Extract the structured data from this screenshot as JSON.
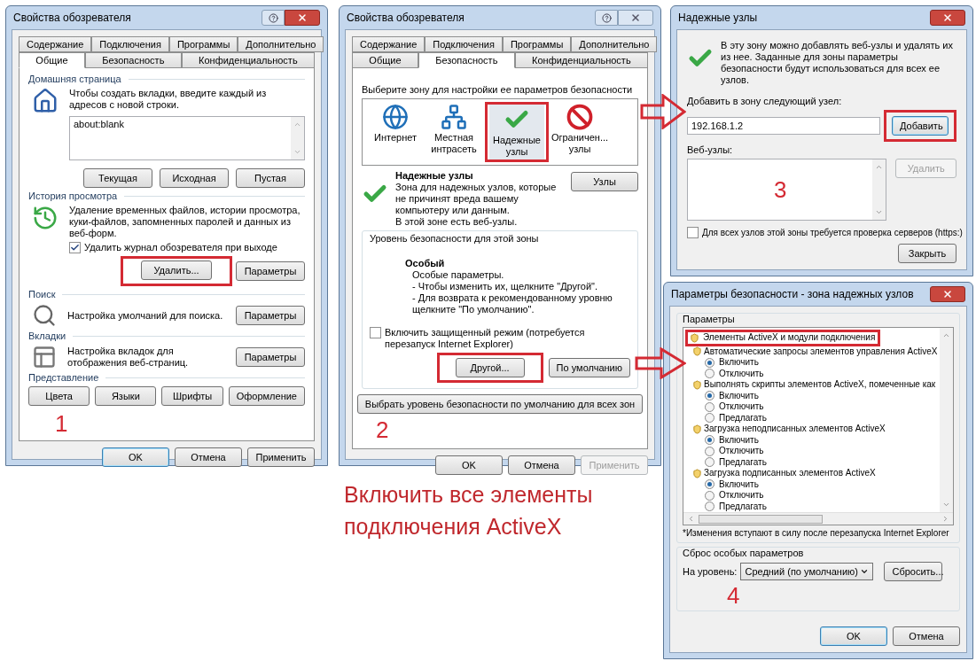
{
  "general_dialog": {
    "title": "Свойства обозревателя",
    "active": true,
    "has_help": true,
    "tab_rows": [
      [
        {
          "label": "Содержание",
          "selected": false
        },
        {
          "label": "Подключения",
          "selected": false
        },
        {
          "label": "Программы",
          "selected": false
        },
        {
          "label": "Дополнительно",
          "selected": false
        }
      ],
      [
        {
          "label": "Общие",
          "selected": true
        },
        {
          "label": "Безопасность",
          "selected": false
        },
        {
          "label": "Конфиденциальность",
          "selected": false
        }
      ]
    ],
    "home": {
      "label": "Домашняя страница",
      "text": "Чтобы создать вкладки, введите каждый из адресов с новой строки.",
      "value": "about:blank",
      "buttons": [
        "Текущая",
        "Исходная",
        "Пустая"
      ]
    },
    "history": {
      "label": "История просмотра",
      "text": "Удаление временных файлов, истории просмотра, куки-файлов, запомненных паролей и данных из веб-форм.",
      "checkbox": {
        "label": "Удалить журнал обозревателя при выходе",
        "checked": true
      },
      "buttons": [
        "Удалить...",
        "Параметры"
      ]
    },
    "search": {
      "label": "Поиск",
      "text": "Настройка умолчаний для поиска.",
      "button": "Параметры"
    },
    "tabs": {
      "label": "Вкладки",
      "text": "Настройка вкладок для отображения веб-страниц.",
      "button": "Параметры"
    },
    "appearance": {
      "label": "Представление",
      "buttons": [
        "Цвета",
        "Языки",
        "Шрифты",
        "Оформление"
      ]
    },
    "step": "1",
    "footer_buttons": [
      {
        "label": "OK",
        "default": true,
        "disabled": false
      },
      {
        "label": "Отмена",
        "default": false,
        "disabled": false
      },
      {
        "label": "Применить",
        "default": false,
        "disabled": false
      }
    ]
  },
  "security_dialog": {
    "title": "Свойства обозревателя",
    "active": false,
    "has_help": true,
    "tab_rows": [
      [
        {
          "label": "Содержание",
          "selected": false
        },
        {
          "label": "Подключения",
          "selected": false
        },
        {
          "label": "Программы",
          "selected": false
        },
        {
          "label": "Дополнительно",
          "selected": false
        }
      ],
      [
        {
          "label": "Общие",
          "selected": false
        },
        {
          "label": "Безопасность",
          "selected": true
        },
        {
          "label": "Конфиденциальность",
          "selected": false
        }
      ]
    ],
    "zone_prompt": "Выберите зону для настройки ее параметров безопасности",
    "zones": [
      {
        "kind": "globe",
        "label": "Интернет",
        "selected": false
      },
      {
        "kind": "intranet",
        "label": "Местная интрасеть",
        "selected": false
      },
      {
        "kind": "trusted",
        "label": "Надежные узлы",
        "selected": true
      },
      {
        "kind": "restricted",
        "label": "Ограничен... узлы",
        "selected": false
      }
    ],
    "zone_title": "Надежные узлы",
    "zone_text": "Зона для надежных узлов, которые не причинят вреда вашему компьютеру или данным.",
    "zone_note": "В этой зоне есть веб-узлы.",
    "sites_button": "Узлы",
    "level_group": "Уровень безопасности для этой зоны",
    "level_name": "Особый",
    "level_lines": [
      "Особые параметры.",
      "- Чтобы изменить их, щелкните \"Другой\".",
      "- Для возврата к рекомендованному уровню щелкните \"По умолчанию\"."
    ],
    "protected_mode": {
      "label": "Включить защищенный режим (потребуется перезапуск Internet Explorer)",
      "checked": false
    },
    "level_buttons": [
      "Другой...",
      "По умолчанию"
    ],
    "reset_all_button": "Выбрать уровень безопасности по умолчанию для всех зон",
    "step": "2",
    "footer_buttons": [
      {
        "label": "OK",
        "default": false,
        "disabled": false
      },
      {
        "label": "Отмена",
        "default": false,
        "disabled": false
      },
      {
        "label": "Применить",
        "default": false,
        "disabled": true
      }
    ]
  },
  "trusted_sites_dialog": {
    "title": "Надежные узлы",
    "active": true,
    "intro": "В эту зону можно добавлять веб-узлы и удалять их из нее. Заданные для зоны параметры безопасности будут использоваться для всех ее узлов.",
    "add_label": "Добавить в зону следующий узел:",
    "add_value": "192.168.1.2",
    "add_button": "Добавить",
    "sites_label": "Веб-узлы:",
    "remove_button": {
      "label": "Удалить",
      "disabled": true
    },
    "step": "3",
    "https_checkbox": {
      "label": "Для всех узлов этой зоны требуется проверка серверов (https:)",
      "checked": false
    },
    "close_button": "Закрыть"
  },
  "security_settings_dialog": {
    "title": "Параметры безопасности - зона надежных узлов",
    "active": true,
    "group_label": "Параметры",
    "tree": [
      {
        "label": "Элементы ActiveX и модули подключения",
        "children": [
          {
            "label": "Автоматические запросы элементов управления ActiveX",
            "options": [
              {
                "label": "Включить",
                "selected": true
              },
              {
                "label": "Отключить",
                "selected": false
              }
            ]
          },
          {
            "label": "Выполнять скрипты элементов ActiveX, помеченные как",
            "options": [
              {
                "label": "Включить",
                "selected": true
              },
              {
                "label": "Отключить",
                "selected": false
              },
              {
                "label": "Предлагать",
                "selected": false
              }
            ]
          },
          {
            "label": "Загрузка неподписанных элементов ActiveX",
            "options": [
              {
                "label": "Включить",
                "selected": true
              },
              {
                "label": "Отключить",
                "selected": false
              },
              {
                "label": "Предлагать",
                "selected": false
              }
            ]
          },
          {
            "label": "Загрузка подписанных элементов ActiveX",
            "options": [
              {
                "label": "Включить",
                "selected": true
              },
              {
                "label": "Отключить",
                "selected": false
              },
              {
                "label": "Предлагать",
                "selected": false
              }
            ]
          }
        ]
      }
    ],
    "note": "*Изменения вступают в силу после перезапуска Internet Explorer",
    "reset_group": "Сброс особых параметров",
    "level_label": "На уровень:",
    "level_value": "Средний (по умолчанию)",
    "reset_button": "Сбросить...",
    "step": "4",
    "footer_buttons": [
      {
        "label": "OK",
        "default": true,
        "disabled": false
      },
      {
        "label": "Отмена",
        "default": false,
        "disabled": false
      }
    ]
  },
  "caption": "Включить все элементы подключения ActiveX"
}
